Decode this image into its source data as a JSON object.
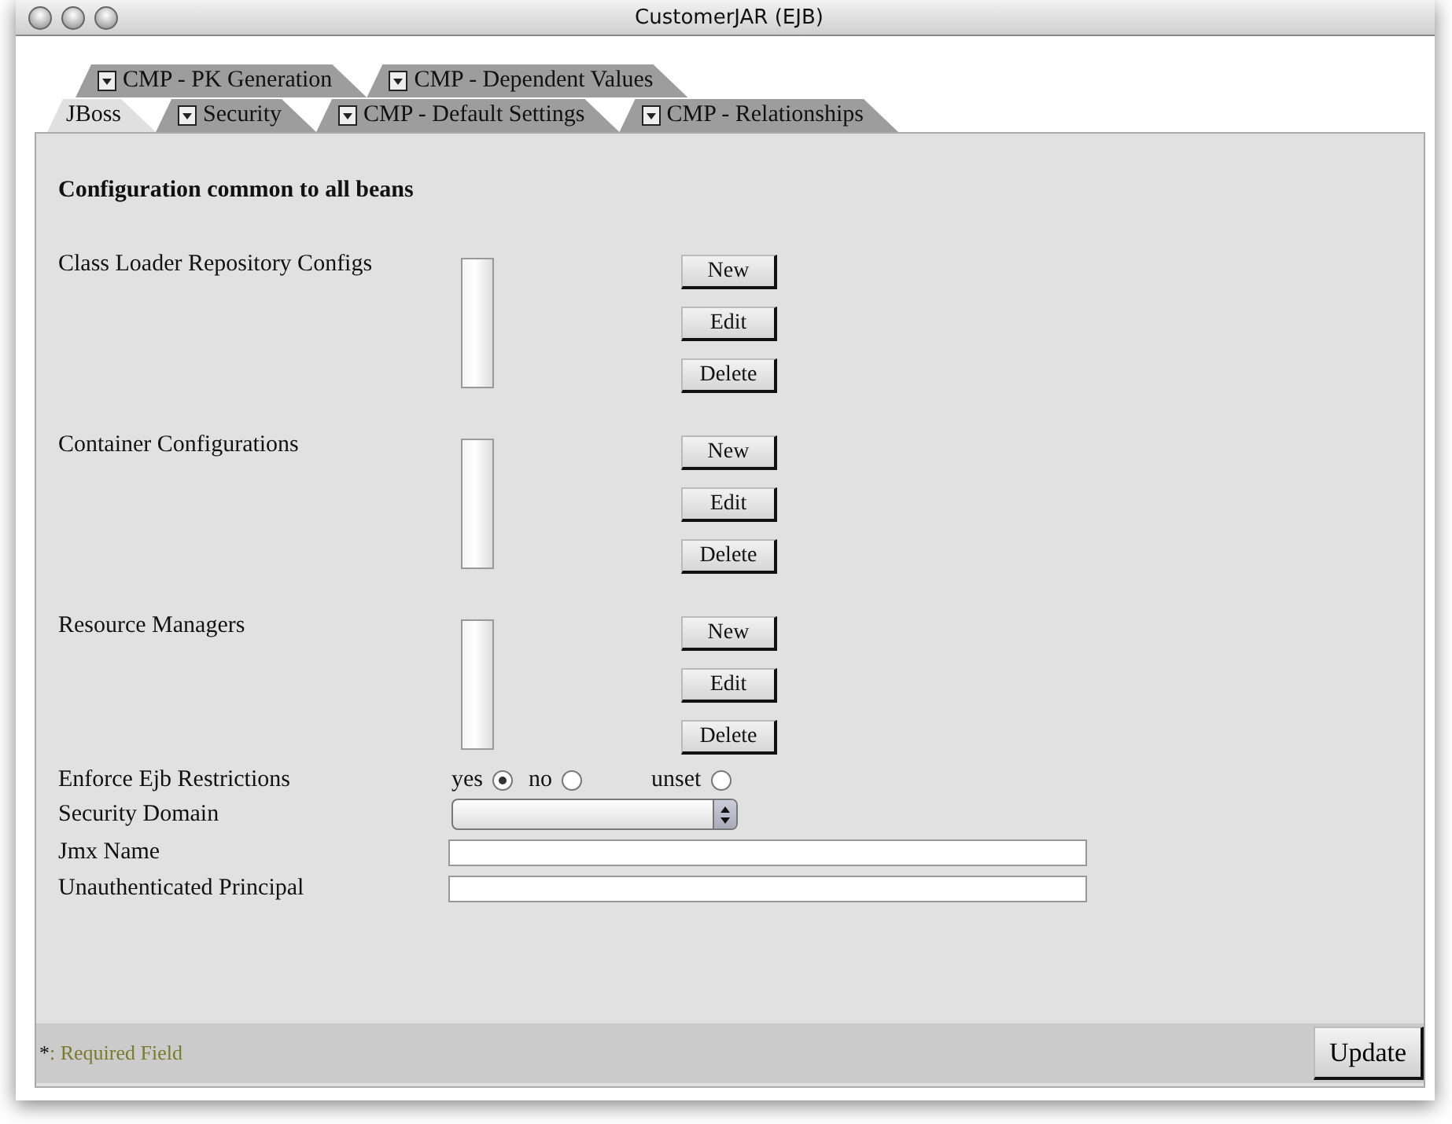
{
  "window": {
    "title": "CustomerJAR (EJB)"
  },
  "tab_rows": [
    {
      "tabs": [
        {
          "label": "CMP - PK Generation",
          "selected": false,
          "menu": true
        },
        {
          "label": "CMP - Dependent Values",
          "selected": false,
          "menu": true
        }
      ]
    },
    {
      "tabs": [
        {
          "label": "JBoss",
          "selected": true,
          "menu": false
        },
        {
          "label": "Security",
          "selected": false,
          "menu": true
        },
        {
          "label": "CMP - Default Settings",
          "selected": false,
          "menu": true
        },
        {
          "label": "CMP - Relationships",
          "selected": false,
          "menu": true
        }
      ]
    }
  ],
  "heading": "Configuration common to all beans",
  "list_sections": [
    {
      "label": "Class Loader Repository Configs",
      "buttons": [
        "New",
        "Edit",
        "Delete"
      ]
    },
    {
      "label": "Container Configurations",
      "buttons": [
        "New",
        "Edit",
        "Delete"
      ]
    },
    {
      "label": "Resource Managers",
      "buttons": [
        "New",
        "Edit",
        "Delete"
      ]
    }
  ],
  "enforce": {
    "label": "Enforce Ejb Restrictions",
    "options": [
      {
        "label": "yes",
        "selected": true
      },
      {
        "label": "no",
        "selected": false
      },
      {
        "label": "unset",
        "selected": false
      }
    ]
  },
  "security_domain": {
    "label": "Security Domain"
  },
  "fields": [
    {
      "label": "Jmx Name"
    },
    {
      "label": "Unauthenticated Principal"
    }
  ],
  "footer": {
    "required_marker": "*",
    "required_text": ": Required Field",
    "button": "Update"
  }
}
